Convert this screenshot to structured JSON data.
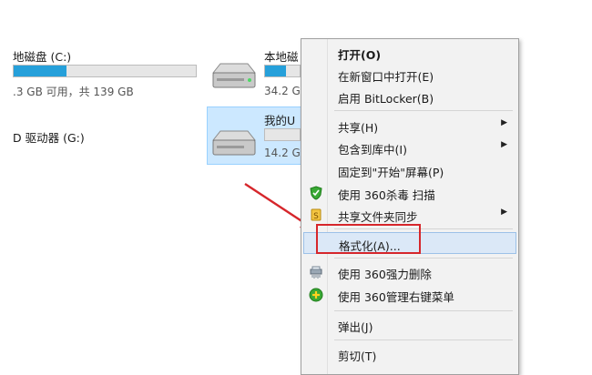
{
  "drives": {
    "c": {
      "label": "地磁盘 (C:)",
      "space": ".3 GB 可用，共 139 GB",
      "used_fraction": 0.29
    },
    "d": {
      "label": "本地磁",
      "space": "34.2 G"
    },
    "g": {
      "label": "D 驱动器 (G:)"
    },
    "usb": {
      "label": "我的U",
      "space": "14.2 G"
    }
  },
  "context_menu": {
    "items": [
      {
        "label": "打开(O)",
        "bold": true,
        "icon": null,
        "submenu": false
      },
      {
        "label": "在新窗口中打开(E)",
        "icon": null,
        "submenu": false
      },
      {
        "label": "启用 BitLocker(B)",
        "icon": null,
        "submenu": false
      },
      {
        "label": "共享(H)",
        "icon": null,
        "submenu": true
      },
      {
        "label": "包含到库中(I)",
        "icon": null,
        "submenu": true
      },
      {
        "label": "固定到\"开始\"屏幕(P)",
        "icon": null,
        "submenu": false
      },
      {
        "label": "使用 360杀毒 扫描",
        "icon": "shield-360-icon",
        "submenu": false
      },
      {
        "label": "共享文件夹同步",
        "icon": "sync-folder-icon",
        "submenu": true
      },
      {
        "label": "格式化(A)...",
        "icon": null,
        "submenu": false,
        "highlighted": true
      },
      {
        "label": "使用 360强力删除",
        "icon": "shredder-icon",
        "submenu": false
      },
      {
        "label": "使用 360管理右键菜单",
        "icon": "manage-menu-icon",
        "submenu": false
      },
      {
        "label": "弹出(J)",
        "icon": null,
        "submenu": false
      },
      {
        "label": "剪切(T)",
        "icon": null,
        "submenu": false
      }
    ]
  },
  "colors": {
    "annotation": "#d6262b",
    "selection": "#cce8ff",
    "bar_fill": "#26a0da"
  }
}
